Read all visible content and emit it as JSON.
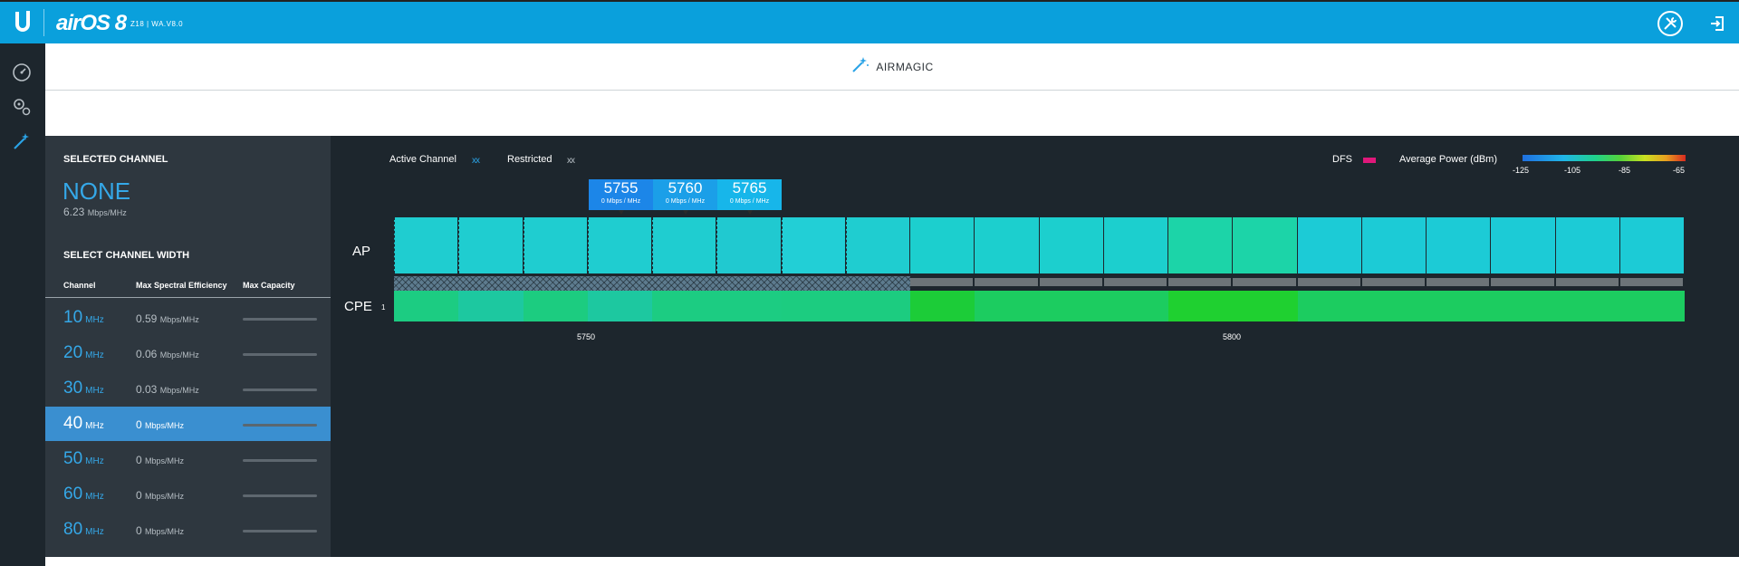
{
  "app": {
    "brand": "airOS 8",
    "device": "Z18 | WA.V8.0"
  },
  "icons": {
    "logo": "ubiquiti-u-logo",
    "tools": "tools-icon",
    "logout": "logout-icon",
    "dashboard": "gauge-icon",
    "settings": "gears-icon",
    "airmagic": "magic-wand-icon"
  },
  "page": {
    "title": "AIRMAGIC"
  },
  "selected": {
    "label": "SELECTED CHANNEL",
    "value": "NONE",
    "efficiency": "6.23",
    "efficiency_unit": "Mbps/MHz"
  },
  "widths": {
    "label": "SELECT CHANNEL WIDTH",
    "headers": [
      "Channel",
      "Max Spectral Efficiency",
      "Max Capacity"
    ],
    "rows": [
      {
        "mhz": "10",
        "unit": "MHz",
        "eff": "0.59",
        "eff_unit": "Mbps/MHz",
        "active": false
      },
      {
        "mhz": "20",
        "unit": "MHz",
        "eff": "0.06",
        "eff_unit": "Mbps/MHz",
        "active": false
      },
      {
        "mhz": "30",
        "unit": "MHz",
        "eff": "0.03",
        "eff_unit": "Mbps/MHz",
        "active": false
      },
      {
        "mhz": "40",
        "unit": "MHz",
        "eff": "0",
        "eff_unit": "Mbps/MHz",
        "active": true
      },
      {
        "mhz": "50",
        "unit": "MHz",
        "eff": "0",
        "eff_unit": "Mbps/MHz",
        "active": false
      },
      {
        "mhz": "60",
        "unit": "MHz",
        "eff": "0",
        "eff_unit": "Mbps/MHz",
        "active": false
      },
      {
        "mhz": "80",
        "unit": "MHz",
        "eff": "0",
        "eff_unit": "Mbps/MHz",
        "active": false
      }
    ]
  },
  "legend": {
    "active": "Active Channel",
    "active_mark": "xx",
    "restricted": "Restricted",
    "restricted_mark": "xx",
    "dfs": "DFS",
    "power": "Average Power (dBm)",
    "power_ticks": [
      "-125",
      "-105",
      "-85",
      "-65"
    ],
    "active_color": "#2aa3e6",
    "dfs_color": "#e0187a"
  },
  "chart": {
    "ap_label": "AP",
    "cpe_label": "CPE",
    "cpe_sub": "1",
    "freq_labels": [
      "5750",
      "5800"
    ],
    "selected_channels": [
      {
        "freq": "5755",
        "sub": "0 Mbps / MHz",
        "color": "#1c86e8"
      },
      {
        "freq": "5760",
        "sub": "0 Mbps / MHz",
        "color": "#1b9fe8"
      },
      {
        "freq": "5765",
        "sub": "0 Mbps / MHz",
        "color": "#17b6ea"
      }
    ]
  },
  "chart_data": {
    "type": "heatmap",
    "title": "",
    "xlabel": "",
    "ylabel": "",
    "x_ticks": [
      5750,
      5800
    ],
    "rows": [
      "AP",
      "CPE"
    ],
    "ap_colors": [
      "#1fcdd0",
      "#1fcdd0",
      "#1fcdd0",
      "#1fcdd0",
      "#1fcdd0",
      "#20c9d0",
      "#22cfd6",
      "#1fcdd0",
      "#1ccfce",
      "#1ccfce",
      "#1ccfce",
      "#1ccfce",
      "#1cd4a8",
      "#1cd4a8",
      "#1ccbd6",
      "#1ccbd6",
      "#1ccbd6",
      "#1ccbd6",
      "#1ccbd6",
      "#1ccbd6"
    ],
    "cpe_colors": [
      "#1ccc82",
      "#1dc8a0",
      "#1ccc80",
      "#1dc8a0",
      "#1ccc82",
      "#1ccc82",
      "#1ccc80",
      "#1ccc80",
      "#1ccc38",
      "#1ccc60",
      "#1ccc60",
      "#1ccc60",
      "#1fd030",
      "#1fd030",
      "#1ccc60",
      "#1ccc60",
      "#1ccc60",
      "#1ccc60",
      "#1ccc60",
      "#1ccc60"
    ],
    "restricted_cells": 8,
    "power_range_dbm": [
      -125,
      -65
    ]
  }
}
